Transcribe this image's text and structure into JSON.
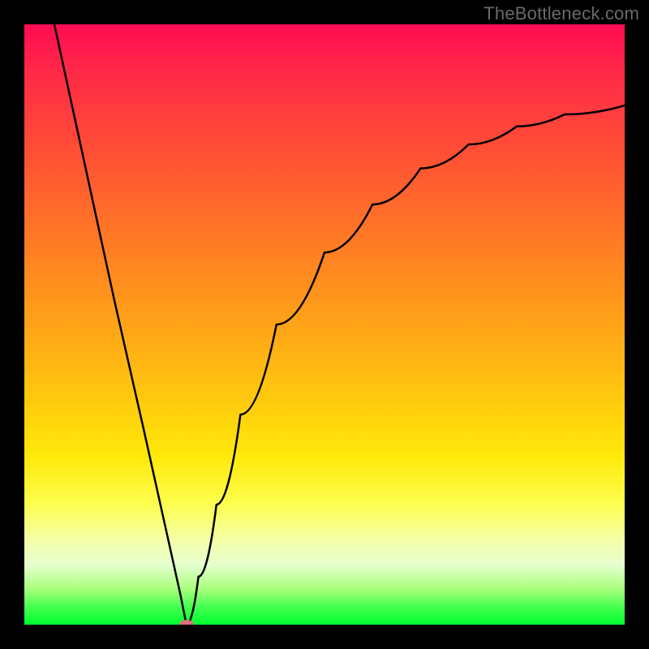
{
  "watermark": "TheBottleneck.com",
  "chart_data": {
    "type": "line",
    "title": "",
    "xlabel": "",
    "ylabel": "",
    "xlim": [
      0,
      100
    ],
    "ylim": [
      0,
      100
    ],
    "grid": false,
    "background": "rainbow-vertical-gradient",
    "marker": {
      "x": 27,
      "y": 0,
      "color": "#db707d"
    },
    "series": [
      {
        "name": "left-branch",
        "x": [
          5,
          10,
          15,
          20,
          24,
          26,
          27
        ],
        "y": [
          100,
          77,
          54,
          32,
          14,
          5,
          0
        ]
      },
      {
        "name": "right-branch",
        "x": [
          27,
          29,
          32,
          36,
          42,
          50,
          58,
          66,
          74,
          82,
          90,
          100
        ],
        "y": [
          0,
          8,
          20,
          35,
          50,
          62,
          70,
          76,
          80,
          83,
          85,
          86.5
        ]
      }
    ]
  },
  "colors": {
    "curve": "#000000",
    "frame": "#000000",
    "marker": "#db707d",
    "watermark": "#6a6a6a"
  }
}
